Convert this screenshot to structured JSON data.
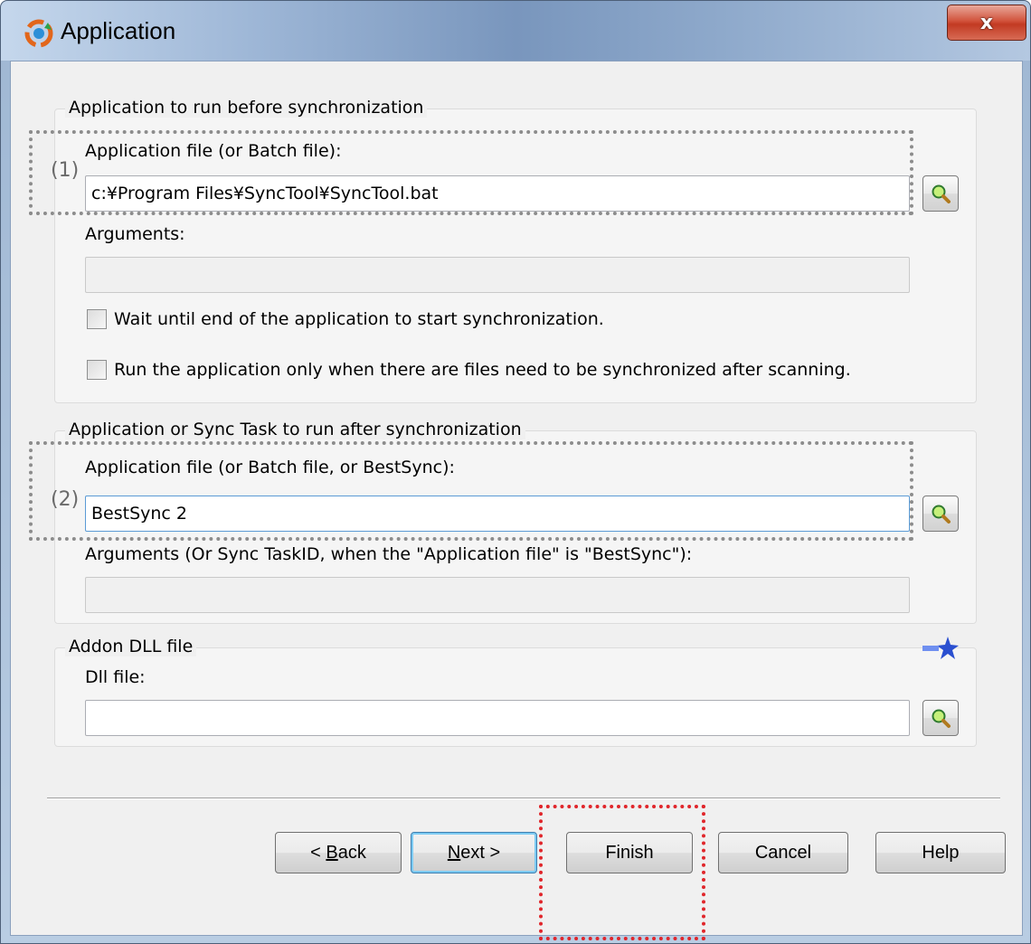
{
  "window": {
    "title": "Application",
    "close_label": "x"
  },
  "before": {
    "legend": "Application to run before synchronization",
    "app_file_label": "Application file (or Batch file):",
    "app_file_value": "c:¥Program Files¥SyncTool¥SyncTool.bat",
    "arguments_label": "Arguments:",
    "arguments_value": "",
    "wait_label": "Wait until end of the application to start synchronization.",
    "wait_checked": false,
    "only_when_label": "Run the application only when there are files need to be synchronized after scanning.",
    "only_when_checked": false
  },
  "after": {
    "legend": "Application or Sync Task to run after synchronization",
    "app_file_label": "Application file (or Batch file, or BestSync):",
    "app_file_value": "BestSync 2",
    "arguments_label": "Arguments (Or Sync TaskID, when the \"Application file\" is \"BestSync\"):",
    "arguments_value": ""
  },
  "addon": {
    "legend": "Addon DLL file",
    "dll_label": "Dll file:",
    "dll_value": ""
  },
  "annotations": {
    "first": "(1)",
    "second": "(2)"
  },
  "buttons": {
    "back_prefix": "< ",
    "back_key": "B",
    "back_rest": "ack",
    "next_key": "N",
    "next_rest": "ext >",
    "finish": "Finish",
    "cancel": "Cancel",
    "help": "Help"
  },
  "colors": {
    "highlight_annotation": "#e0262b",
    "annotation": "#8c8c8c"
  }
}
